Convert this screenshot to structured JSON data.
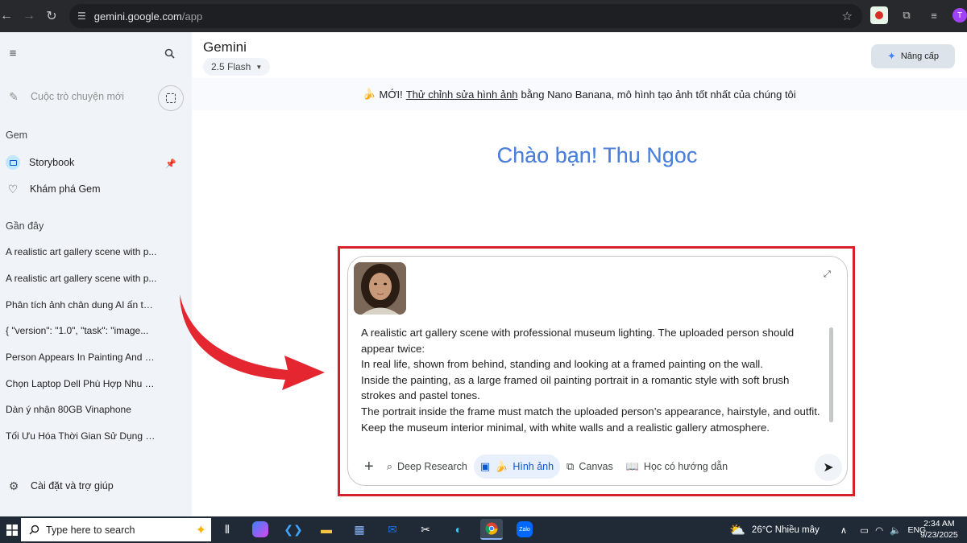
{
  "browser": {
    "url_host": "gemini.google.com",
    "url_path": "/app",
    "profile_initial": "T"
  },
  "sidebar": {
    "new_chat_label": "Cuộc trò chuyện mới",
    "gem_section_title": "Gem",
    "gems": [
      {
        "label": "Storybook",
        "icon": "storybook-icon"
      },
      {
        "label": "Khám phá Gem",
        "icon": "gem-explore-icon"
      }
    ],
    "recent_title": "Gần đây",
    "recent_items": [
      "A realistic art gallery scene with p...",
      "A realistic art gallery scene with p...",
      "Phân tích ảnh chân dung AI ấn tư...",
      "{   \"version\": \"1.0\",   \"task\": \"image...",
      "Person Appears In Painting And R...",
      "Chọn Laptop Dell Phù Hợp Nhu C...",
      "Dàn ý nhận 80GB Vinaphone",
      "Tối Ưu Hóa Thời Gian Sử Dụng Pin..."
    ],
    "settings_label": "Cài đặt và trợ giúp"
  },
  "header": {
    "title": "Gemini",
    "model": "2.5 Flash",
    "upgrade_label": "Nâng cấp"
  },
  "banner": {
    "emoji": "🍌",
    "prefix": "MỚI!",
    "link": "Thử chỉnh sửa hình ảnh",
    "suffix": "bằng Nano Banana, mô hình tạo ảnh tốt nhất của chúng tôi"
  },
  "greeting": "Chào bạn! Thu Ngoc",
  "prompt": {
    "paragraphs": [
      "A realistic art gallery scene with professional museum lighting. The uploaded person should appear twice:",
      "In real life, shown from behind, standing and looking at a framed painting on the wall.",
      "Inside the painting, as a large framed oil painting portrait in a romantic style with soft brush strokes and pastel tones.",
      "The portrait inside the frame must match the uploaded person’s appearance, hairstyle, and outfit. Keep the museum interior minimal, with white walls and a realistic gallery atmosphere."
    ],
    "tools": {
      "deep_research": "Deep Research",
      "image": "Hình ảnh",
      "canvas": "Canvas",
      "guided": "Học có hướng dẫn"
    }
  },
  "taskbar": {
    "search_placeholder": "Type here to search",
    "weather": "26°C  Nhiều mây",
    "lang": "ENG",
    "time": "2:34 AM",
    "date": "9/23/2025"
  },
  "colors": {
    "accent_blue": "#4285f4",
    "highlight_red": "#d6202c",
    "sidebar_bg": "#f0f4f9"
  }
}
